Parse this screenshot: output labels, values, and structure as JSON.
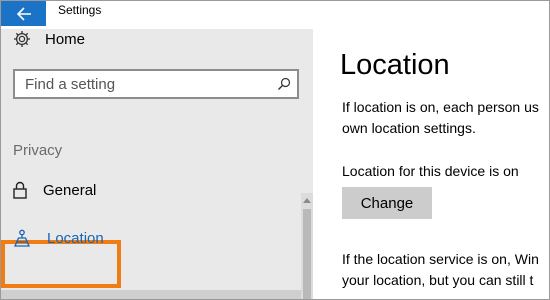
{
  "window": {
    "title": "Settings"
  },
  "titlebar": {
    "back_icon": "back-arrow-icon",
    "accent_color": "#1a73c6"
  },
  "sidebar": {
    "home_label": "Home",
    "home_icon": "gear-icon",
    "search": {
      "placeholder": "Find a setting",
      "icon": "search-icon"
    },
    "section_label": "Privacy",
    "items": [
      {
        "label": "General",
        "icon": "lock-icon",
        "selected": false
      },
      {
        "label": "Location",
        "icon": "location-icon",
        "selected": true,
        "highlight_color": "#f07d14"
      }
    ]
  },
  "main": {
    "title": "Location",
    "paragraph1_lines": [
      "If location is on, each person us",
      "own location settings."
    ],
    "status_text": "Location for this device is on",
    "change_label": "Change",
    "paragraph2_lines": [
      "If the location service is on, Win",
      "your location, but you can still t"
    ]
  }
}
